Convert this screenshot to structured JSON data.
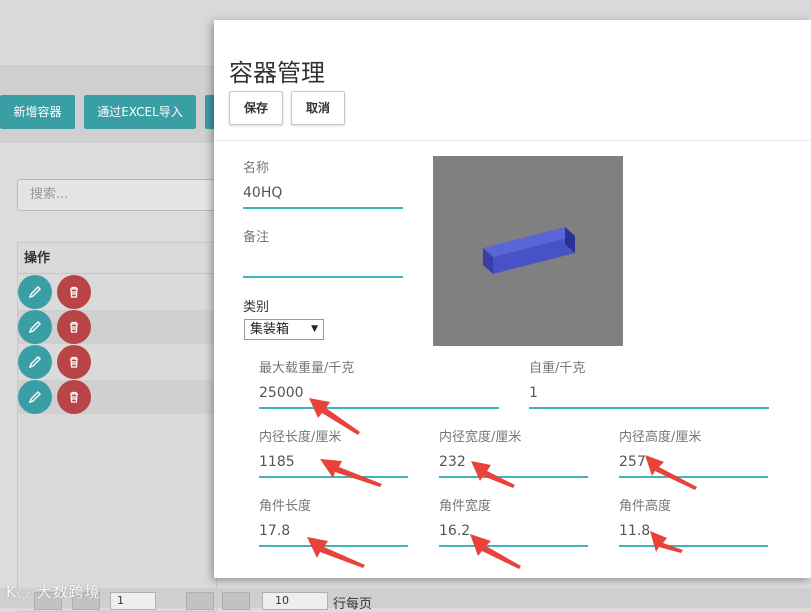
{
  "toolbar": {
    "add_label": "新增容器",
    "import_label": "通过EXCEL导入"
  },
  "search": {
    "placeholder": "搜索..."
  },
  "table": {
    "header_action": "操作"
  },
  "pager": {
    "page_value": "1",
    "page_size": "10",
    "per_page_label": "行每页"
  },
  "watermark": "大数跨境",
  "modal": {
    "title": "容器管理",
    "save_label": "保存",
    "cancel_label": "取消",
    "name_label": "名称",
    "name_value": "40HQ",
    "remark_label": "备注",
    "remark_value": "",
    "category_label": "类别",
    "category_value": "集装箱",
    "max_load_label": "最大载重量/千克",
    "max_load_value": "25000",
    "self_weight_label": "自重/千克",
    "self_weight_value": "1",
    "inner_length_label": "内径长度/厘米",
    "inner_length_value": "1185",
    "inner_width_label": "内径宽度/厘米",
    "inner_width_value": "232",
    "inner_height_label": "内径高度/厘米",
    "inner_height_value": "257",
    "corner_length_label": "角件长度",
    "corner_length_value": "17.8",
    "corner_width_label": "角件宽度",
    "corner_width_value": "16.2",
    "corner_height_label": "角件高度",
    "corner_height_value": "11.8"
  },
  "colors": {
    "accent": "#3fb4bb",
    "teal_button": "#3a9ea5",
    "danger": "#b84447",
    "arrow": "#e8433a",
    "box": "#4a55c8"
  }
}
